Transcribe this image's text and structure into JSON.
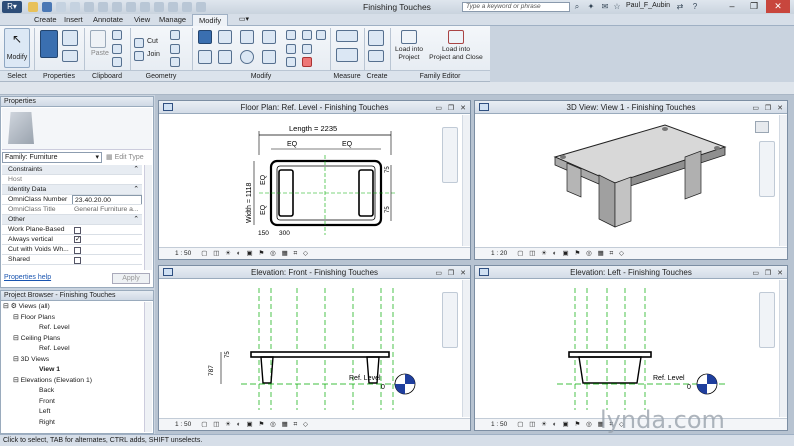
{
  "app": {
    "title": "Finishing Touches",
    "search_placeholder": "Type a keyword or phrase",
    "user": "Paul_F_Aubin"
  },
  "tabs": [
    "Create",
    "Insert",
    "Annotate",
    "View",
    "Manage",
    "Modify"
  ],
  "ribbon": {
    "panels": [
      "Select",
      "Properties",
      "Clipboard",
      "Geometry",
      "Modify",
      "Measure",
      "Create",
      "Family Editor"
    ],
    "modify_label": "Modify",
    "paste_label": "Paste",
    "cut_label": "Cut",
    "join_label": "Join",
    "load_project": "Load into\nProject",
    "load_project_close": "Load into\nProject and Close"
  },
  "properties": {
    "header": "Properties",
    "family_selector": "Family: Furniture",
    "edit_type": "Edit Type",
    "groups": {
      "constraints": "Constraints",
      "identity": "Identity Data",
      "other": "Other"
    },
    "rows": {
      "host": "Host",
      "omni_number_label": "OmniClass Number",
      "omni_number_value": "23.40.20.00",
      "omni_title_label": "OmniClass Title",
      "omni_title_value": "General Furniture a...",
      "work_plane": "Work Plane-Based",
      "always_vertical": "Always vertical",
      "cut_voids": "Cut with Voids Wh...",
      "shared": "Shared"
    },
    "help_link": "Properties help",
    "apply": "Apply"
  },
  "browser": {
    "header": "Project Browser - Finishing Touches",
    "items": [
      "Views (all)",
      "Floor Plans",
      "Ref. Level",
      "Ceiling Plans",
      "Ref. Level",
      "3D Views",
      "View 1",
      "Elevations (Elevation 1)",
      "Back",
      "Front",
      "Left",
      "Right"
    ]
  },
  "views": {
    "floor_plan": {
      "title": "Floor Plan: Ref. Level - Finishing Touches",
      "scale": "1 : 50",
      "dims": {
        "length": "Length = 2235",
        "width": "Width = 1118",
        "eq": "EQ",
        "d75": "75",
        "d150": "150",
        "d300": "300"
      }
    },
    "view3d": {
      "title": "3D View: View 1 - Finishing Touches",
      "scale": "1 : 20"
    },
    "elev_front": {
      "title": "Elevation: Front - Finishing Touches",
      "scale": "1 : 50",
      "level": "Ref. Level",
      "level_val": "0",
      "d787": "787",
      "d75": "75"
    },
    "elev_left": {
      "title": "Elevation: Left - Finishing Touches",
      "scale": "1 : 50",
      "level": "Ref. Level",
      "level_val": "0"
    }
  },
  "status": "Click to select, TAB for alternates, CTRL adds, SHIFT unselects.",
  "watermark": "lynda.com"
}
